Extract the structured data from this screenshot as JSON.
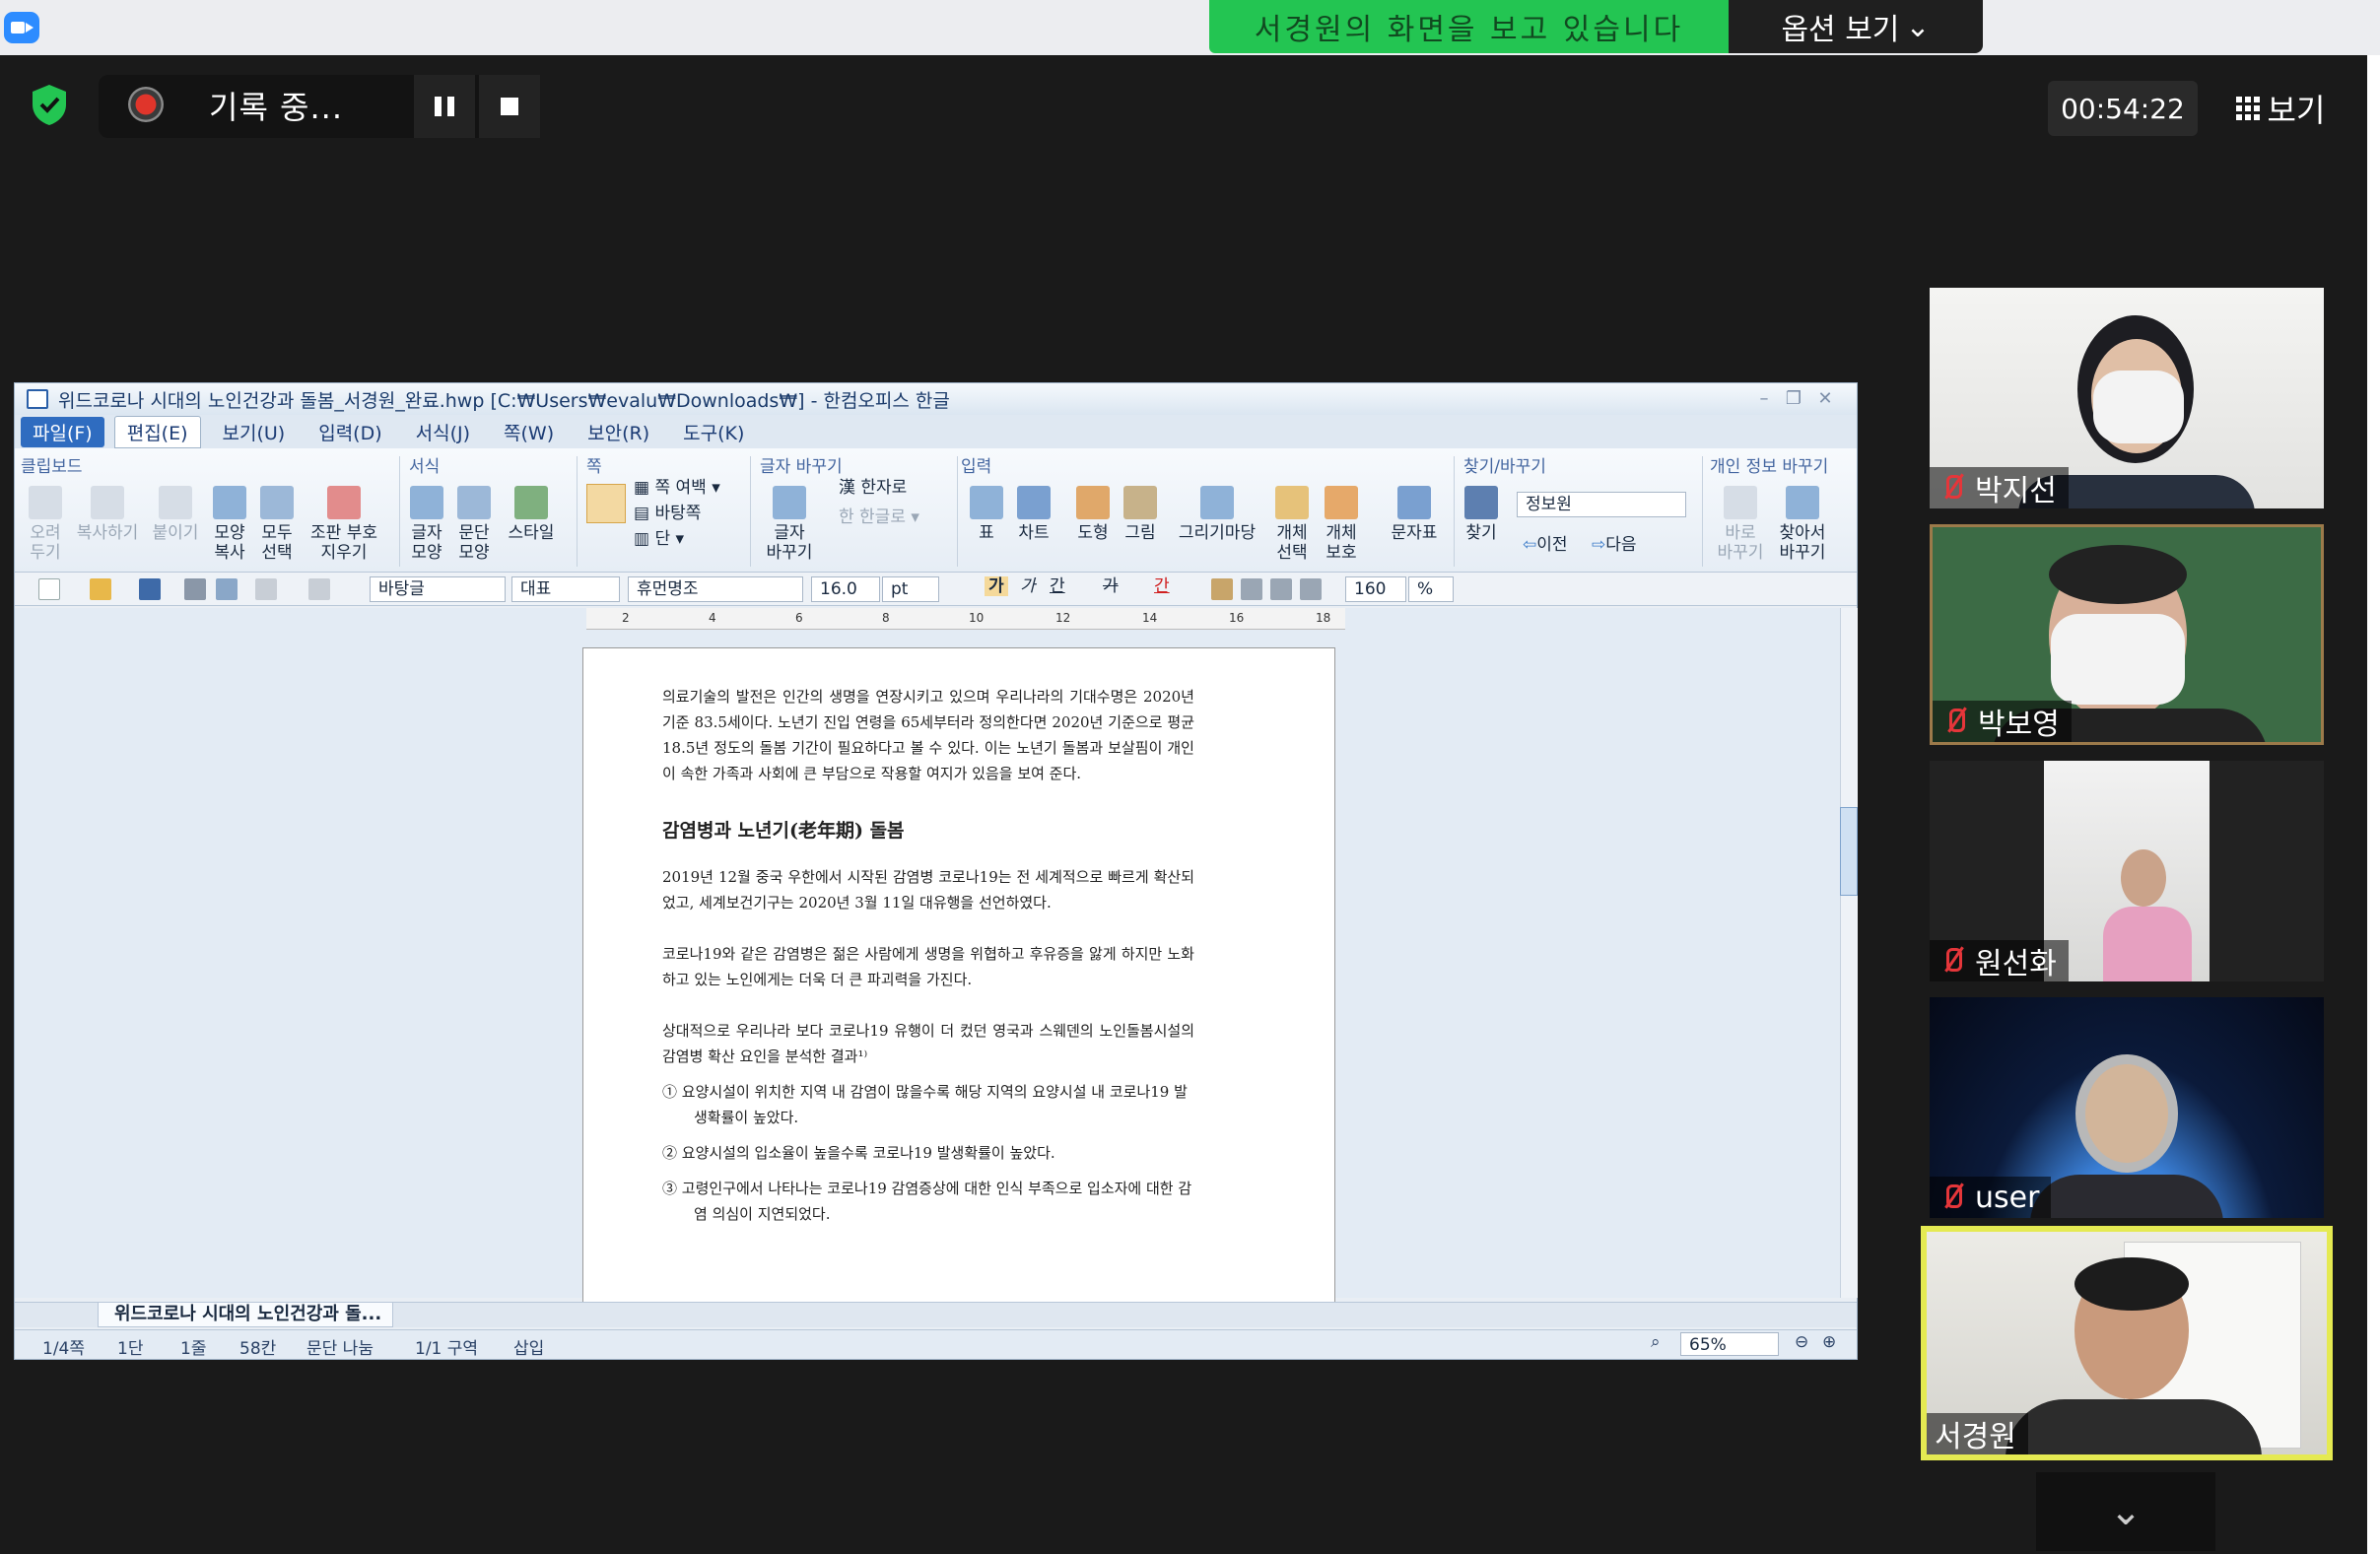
{
  "topbar": {
    "share_banner": "서경원의 화면을 보고 있습니다",
    "options_label": "옵션 보기",
    "options_chevron": "⌄"
  },
  "recording": {
    "label": "기록 중...",
    "timer": "00:54:22",
    "view_label": "보기"
  },
  "hwp": {
    "title": "위드코로나 시대의 노인건강과 돌봄_서경원_완료.hwp [C:₩Users₩evalu₩Downloads₩] - 한컴오피스 한글",
    "menus": [
      "파일(F)",
      "편집(E)",
      "보기(U)",
      "입력(D)",
      "서식(J)",
      "쪽(W)",
      "보안(R)",
      "도구(K)"
    ],
    "groups": {
      "clipboard": "클립보드",
      "format": "서식",
      "page": "쪽",
      "replace": "글자 바꾸기",
      "insert": "입력",
      "find": "찾기/바꾸기",
      "privacy": "개인 정보 바꾸기"
    },
    "ribbon": {
      "cut": "오려\n두기",
      "copy": "복사하기",
      "paste": "붙이기",
      "shape_copy": "모양\n복사",
      "select_all": "모두\n선택",
      "clear_marks": "조판 부호\n지우기",
      "char_shape": "글자\n모양",
      "para_shape": "문단\n모양",
      "style": "스타일",
      "margin": "쪽 여백",
      "background": "바탕쪽",
      "column": "단",
      "hanja": "한자로",
      "hangul": "한글로",
      "char_replace": "글자\n바꾸기",
      "table": "표",
      "chart": "차트",
      "shape": "도형",
      "picture": "그림",
      "clipart": "그리기마당",
      "object_select": "개체\n선택",
      "object_protect": "개체\n보호",
      "charmap": "문자표",
      "find": "찾기",
      "find_value": "정보원",
      "prev": "이전",
      "next": "다음",
      "quick_replace": "바로\n바꾸기",
      "find_replace": "찾아서\n바꾸기"
    },
    "toolbar": {
      "style": "바탕글",
      "font_lang": "대표",
      "font": "휴먼명조",
      "size": "16.0",
      "unit": "pt",
      "bold": "가",
      "italic": "가",
      "underline": "간",
      "strike": "가",
      "color": "간",
      "line_spacing": "160",
      "percent": "%"
    },
    "ruler_marks": [
      "2",
      "4",
      "6",
      "8",
      "10",
      "12",
      "14",
      "16",
      "18"
    ],
    "document": {
      "p1": "의료기술의 발전은 인간의 생명을 연장시키고 있으며 우리나라의 기대수명은 2020년 기준 83.5세이다. 노년기 진입 연령을 65세부터라 정의한다면 2020년 기준으로 평균 18.5년 정도의 돌봄 기간이 필요하다고 볼 수 있다. 이는 노년기 돌봄과 보살핌이 개인이 속한 가족과 사회에 큰 부담으로 작용할 여지가 있음을 보여 준다.",
      "heading": "감염병과 노년기(老年期) 돌봄",
      "p2": "2019년 12월 중국 우한에서 시작된 감염병 코로나19는 전 세계적으로 빠르게 확산되었고, 세계보건기구는 2020년 3월 11일 대유행을 선언하였다.",
      "p3": "코로나19와 같은 감염병은 젊은 사람에게 생명을 위협하고 후유증을 앓게 하지만 노화하고 있는 노인에게는 더욱 더 큰 파괴력을 가진다.",
      "p4": "상대적으로 우리나라 보다 코로나19 유행이 더 컸던 영국과 스웨덴의 노인돌봄시설의 감염병 확산 요인을 분석한 결과¹⁾",
      "items": [
        "① 요양시설이 위치한 지역 내 감염이 많을수록 해당 지역의 요양시설 내 코로나19 발생확률이 높았다.",
        "② 요양시설의 입소율이 높을수록 코로나19 발생확률이 높았다.",
        "③ 고령인구에서 나타나는 코로나19 감염증상에 대한 인식 부족으로 입소자에 대한 감염 의심이 지연되었다."
      ]
    },
    "tab_label": "위드코로나 시대의 노인건강과 돌...",
    "status": {
      "page": "1/4쪽",
      "col": "1단",
      "line": "1줄",
      "cell": "58칸",
      "break": "문단 나눔",
      "section": "1/1 구역",
      "mode": "삽입",
      "zoom": "65%"
    }
  },
  "participants": [
    {
      "name": "박지선",
      "muted": true
    },
    {
      "name": "박보영",
      "muted": true
    },
    {
      "name": "원선화",
      "muted": true
    },
    {
      "name": "user",
      "muted": true
    },
    {
      "name": "서경원",
      "muted": false,
      "active_speaker": true
    }
  ],
  "colors": {
    "share_green": "#23c552",
    "active_border": "#e5ea52",
    "mute_red": "#e5363a",
    "zoom_blue": "#2d8cff"
  },
  "icons": {
    "more": "chevron-down-icon"
  }
}
